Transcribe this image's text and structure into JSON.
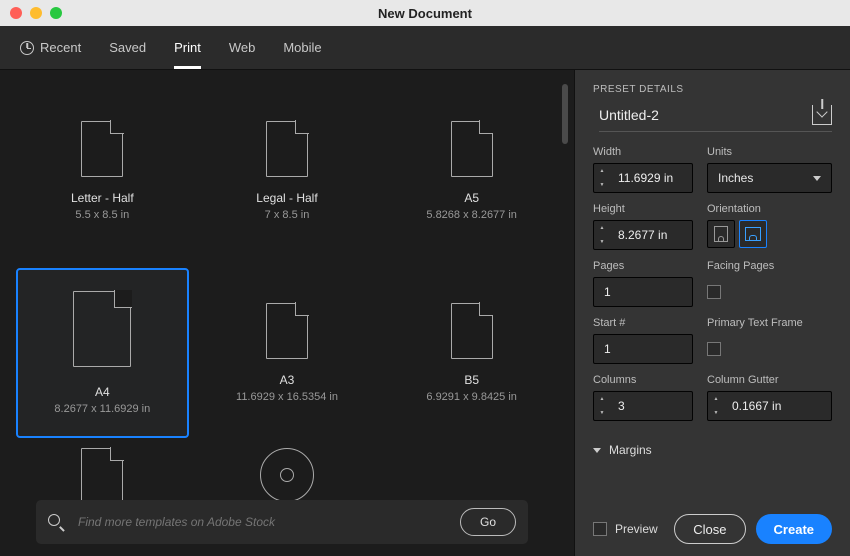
{
  "window": {
    "title": "New Document"
  },
  "tabs": {
    "recent": "Recent",
    "saved": "Saved",
    "print": "Print",
    "web": "Web",
    "mobile": "Mobile",
    "active": "print"
  },
  "presets": [
    {
      "name": "Letter - Half",
      "dims": "5.5 x 8.5 in"
    },
    {
      "name": "Legal - Half",
      "dims": "7 x 8.5 in"
    },
    {
      "name": "A5",
      "dims": "5.8268 x 8.2677 in"
    },
    {
      "name": "A4",
      "dims": "8.2677 x 11.6929 in",
      "selected": true
    },
    {
      "name": "A3",
      "dims": "11.6929 x 16.5354 in"
    },
    {
      "name": "B5",
      "dims": "6.9291 x 9.8425 in"
    }
  ],
  "search": {
    "placeholder": "Find more templates on Adobe Stock",
    "go": "Go"
  },
  "details": {
    "header": "PRESET DETAILS",
    "docname": "Untitled-2",
    "width_label": "Width",
    "width_value": "11.6929 in",
    "units_label": "Units",
    "units_value": "Inches",
    "height_label": "Height",
    "height_value": "8.2677 in",
    "orientation_label": "Orientation",
    "pages_label": "Pages",
    "pages_value": "1",
    "facing_label": "Facing Pages",
    "start_label": "Start #",
    "start_value": "1",
    "primary_label": "Primary Text Frame",
    "columns_label": "Columns",
    "columns_value": "3",
    "gutter_label": "Column Gutter",
    "gutter_value": "0.1667 in",
    "margins_label": "Margins",
    "preview_label": "Preview",
    "close": "Close",
    "create": "Create"
  }
}
